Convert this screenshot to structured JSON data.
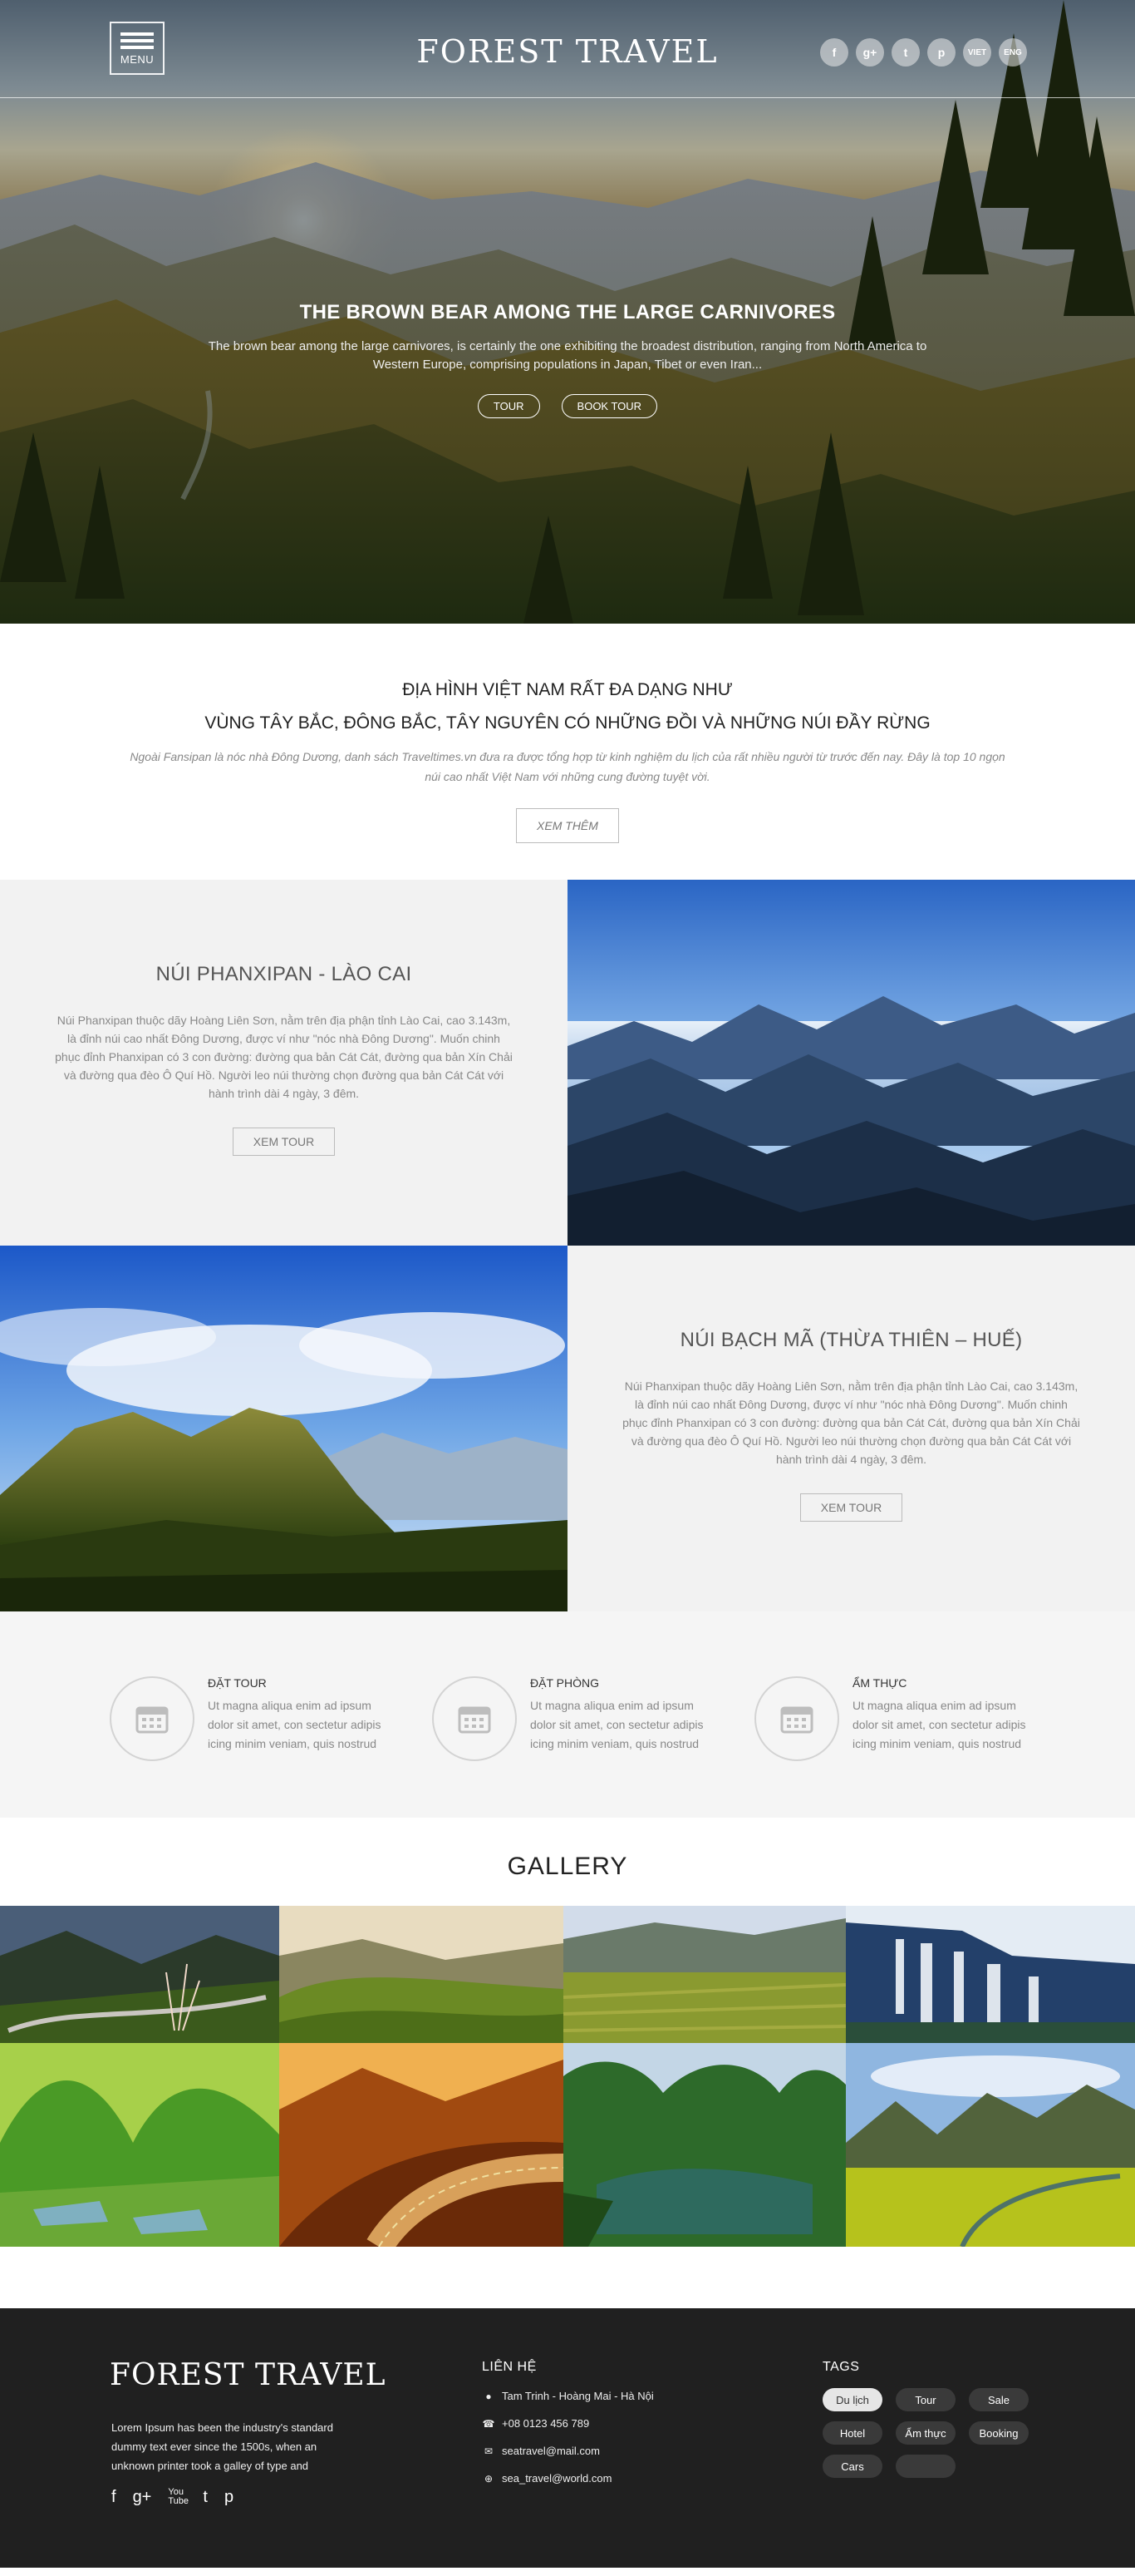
{
  "header": {
    "menu_label": "MENU",
    "logo": "FOREST TRAVEL",
    "socials": [
      "f",
      "g+",
      "t",
      "p"
    ],
    "languages": [
      "VIET",
      "ENG"
    ]
  },
  "hero": {
    "title": "THE BROWN BEAR AMONG THE LARGE CARNIVORES",
    "description": "The brown bear among the large carnivores, is certainly the one exhibiting the broadest distribution, ranging from North America to Western Europe, comprising populations in Japan, Tibet or even Iran...",
    "buttons": [
      "TOUR",
      "BOOK TOUR"
    ]
  },
  "intro": {
    "title_line1": "ĐỊA HÌNH VIỆT NAM RẤT ĐA DẠNG NHƯ",
    "title_line2": "VÙNG TÂY BẮC, ĐÔNG BẮC, TÂY NGUYÊN CÓ NHỮNG ĐỒI VÀ NHỮNG NÚI ĐẦY RỪNG",
    "text": "Ngoài Fansipan là nóc nhà Đông Dương, danh sách Traveltimes.vn đưa ra được tổng hợp từ kinh nghiệm du lịch của rất nhiều người từ trước đến nay. Đây là top 10 ngọn núi cao nhất Việt Nam với những cung đường tuyệt vời.",
    "button": "XEM THÊM"
  },
  "features": [
    {
      "title": "NÚI PHANXIPAN - LÀO CAI",
      "text": "Núi Phanxipan thuộc dãy Hoàng Liên Sơn, nằm trên địa phận tỉnh Lào Cai, cao 3.143m, là đỉnh núi cao nhất Đông Dương, được ví như \"nóc nhà Đông Dương\". Muốn chinh phục đỉnh Phanxipan có 3 con đường: đường qua bản Cát Cát, đường qua bản Xín Chải và đường qua đèo Ô Quí Hồ. Người leo núi thường chọn đường qua bản Cát Cát với hành trình dài 4 ngày, 3 đêm.",
      "button": "XEM TOUR"
    },
    {
      "title": "NÚI BẠCH MÃ (THỪA THIÊN – HUẾ)",
      "text": "Núi Phanxipan thuộc dãy Hoàng Liên Sơn, nằm trên địa phận tỉnh Lào Cai, cao 3.143m, là đỉnh núi cao nhất Đông Dương, được ví như \"nóc nhà Đông Dương\". Muốn chinh phục đỉnh Phanxipan có 3 con đường: đường qua bản Cát Cát, đường qua bản Xín Chải và đường qua đèo Ô Quí Hồ. Người leo núi thường chọn đường qua bản Cát Cát với hành trình dài 4 ngày, 3 đêm.",
      "button": "XEM TOUR"
    }
  ],
  "services": [
    {
      "title": "ĐẶT TOUR",
      "text": "Ut magna aliqua enim ad ipsum dolor sit amet, con sectetur adipis icing minim veniam, quis nostrud"
    },
    {
      "title": "ĐẶT PHÒNG",
      "text": "Ut magna aliqua enim ad ipsum dolor sit amet, con sectetur adipis icing minim veniam, quis nostrud"
    },
    {
      "title": "ẨM THỰC",
      "text": "Ut magna aliqua enim ad ipsum dolor sit amet, con sectetur adipis icing minim veniam, quis nostrud"
    }
  ],
  "gallery": {
    "title": "GALLERY"
  },
  "footer": {
    "logo": "FOREST TRAVEL",
    "about": "Lorem Ipsum has been the industry's standard dummy text ever since the 1500s, when an unknown printer took a galley of type and",
    "contact_title": "LIÊN HỆ",
    "address": "Tam Trinh - Hoàng Mai - Hà Nội",
    "phone": "+08 0123 456 789",
    "email": "seatravel@mail.com",
    "web": "sea_travel@world.com",
    "tags_title": "TAGS",
    "tags": [
      "Du lịch",
      "Tour",
      "Sale",
      "Hotel",
      "Ẩm thực",
      "Booking",
      "Cars",
      ""
    ],
    "social_icons": [
      "f",
      "g+",
      "You Tube",
      "t",
      "p"
    ]
  },
  "colors": {
    "footer_bg": "#202020",
    "light_section": "#f2f2f2",
    "services_bg": "#f5f5f5"
  }
}
